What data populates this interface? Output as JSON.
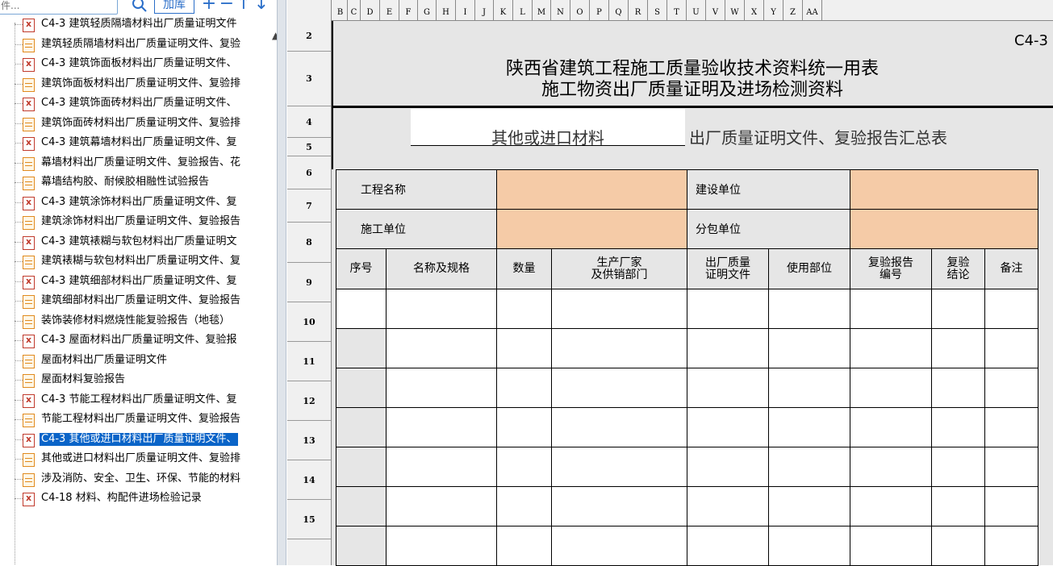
{
  "toolbar": {
    "search_placeholder": "件...",
    "search_icon": "search-icon",
    "add_lib": "加库",
    "add_icon": "+",
    "remove_icon": "−",
    "up_icon": "↑",
    "down_icon": "↓"
  },
  "tree": [
    {
      "icon": "red",
      "label": "C4-3 建筑轻质隔墙材料出厂质量证明文件"
    },
    {
      "icon": "orange",
      "label": "建筑轻质隔墙材料出厂质量证明文件、复验"
    },
    {
      "icon": "red",
      "label": "C4-3 建筑饰面板材料出厂质量证明文件、"
    },
    {
      "icon": "orange",
      "label": "建筑饰面板材料出厂质量证明文件、复验排"
    },
    {
      "icon": "red",
      "label": "C4-3 建筑饰面砖材料出厂质量证明文件、"
    },
    {
      "icon": "orange",
      "label": "建筑饰面砖材料出厂质量证明文件、复验排"
    },
    {
      "icon": "red",
      "label": "C4-3 建筑幕墙材料出厂质量证明文件、复"
    },
    {
      "icon": "orange",
      "label": "幕墙材料出厂质量证明文件、复验报告、花"
    },
    {
      "icon": "orange",
      "label": "幕墙结构胶、耐候胶相融性试验报告"
    },
    {
      "icon": "red",
      "label": "C4-3 建筑涂饰材料出厂质量证明文件、复"
    },
    {
      "icon": "orange",
      "label": "建筑涂饰材料出厂质量证明文件、复验报告"
    },
    {
      "icon": "red",
      "label": "C4-3 建筑裱糊与软包材料出厂质量证明文"
    },
    {
      "icon": "orange",
      "label": "建筑裱糊与软包材料出厂质量证明文件、复"
    },
    {
      "icon": "red",
      "label": "C4-3 建筑细部材料出厂质量证明文件、复"
    },
    {
      "icon": "orange",
      "label": "建筑细部材料出厂质量证明文件、复验报告"
    },
    {
      "icon": "orange",
      "label": "装饰装修材料燃烧性能复验报告（地毯）"
    },
    {
      "icon": "red",
      "label": "C4-3 屋面材料出厂质量证明文件、复验报"
    },
    {
      "icon": "orange",
      "label": "屋面材料出厂质量证明文件"
    },
    {
      "icon": "orange",
      "label": "屋面材料复验报告"
    },
    {
      "icon": "red",
      "label": "C4-3 节能工程材料出厂质量证明文件、复"
    },
    {
      "icon": "orange",
      "label": "节能工程材料出厂质量证明文件、复验报告"
    },
    {
      "icon": "red",
      "label": "C4-3 其他或进口材料出厂质量证明文件、",
      "selected": true
    },
    {
      "icon": "orange",
      "label": "其他或进口材料出厂质量证明文件、复验排"
    },
    {
      "icon": "orange",
      "label": "涉及消防、安全、卫生、环保、节能的材料"
    },
    {
      "icon": "red",
      "label": "C4-18 材料、构配件进场检验记录"
    }
  ],
  "columns": [
    "B",
    "C",
    "D",
    "E",
    "F",
    "G",
    "H",
    "I",
    "J",
    "K",
    "L",
    "M",
    "N",
    "O",
    "P",
    "Q",
    "R",
    "S",
    "T",
    "U",
    "V",
    "W",
    "X",
    "Y",
    "Z",
    "AA"
  ],
  "rows": [
    "2",
    "3",
    "4",
    "5",
    "6",
    "7",
    "8",
    "9",
    "10",
    "11",
    "12",
    "13",
    "14",
    "15"
  ],
  "doc": {
    "code": "C4-3",
    "title1": "陕西省建筑工程施工质量验收技术资料统一用表",
    "title2": "施工物资出厂质量证明及进场检测资料",
    "material": "其他或进口材料",
    "subtitle": "出厂质量证明文件、复验报告汇总表",
    "project_name_label": "工程名称",
    "builder_label": "建设单位",
    "contractor_label": "施工单位",
    "subcontractor_label": "分包单位",
    "headers": [
      "序号",
      "名称及规格",
      "数量",
      "生产厂家\n及供销部门",
      "出厂质量\n证明文件",
      "使用部位",
      "复验报告\n编号",
      "复验\n结论",
      "备注"
    ]
  }
}
